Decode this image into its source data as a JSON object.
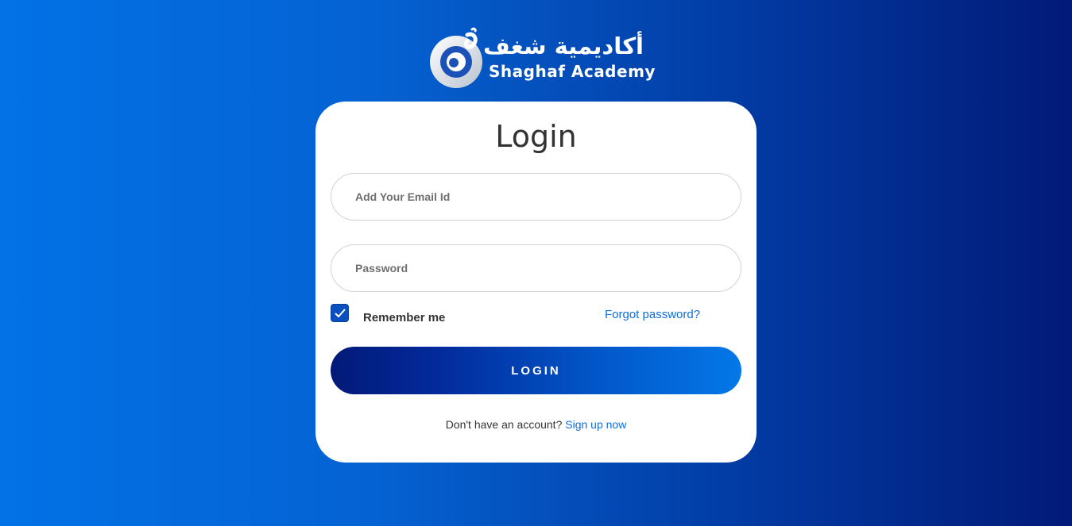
{
  "brand": {
    "arabic_name": "أكاديمية شغف",
    "latin_name": "Shaghaf Academy",
    "logo_icon": "shaghaf-logo-icon"
  },
  "login": {
    "title": "Login",
    "email_placeholder": "Add Your Email Id",
    "email_value": "",
    "password_placeholder": "Password",
    "password_value": "",
    "remember_label": "Remember me",
    "remember_checked": true,
    "forgot_password": "Forgot password?",
    "submit_label": "LOGIN",
    "signup_prompt": "Don't have an account?",
    "signup_link": "Sign up now"
  },
  "colors": {
    "background_left": "#0272e6",
    "background_right": "#021a78",
    "accent_link": "#0d6ee0",
    "checkbox": "#0a4fbf",
    "button_left": "#021a78",
    "button_right": "#0478e8"
  }
}
